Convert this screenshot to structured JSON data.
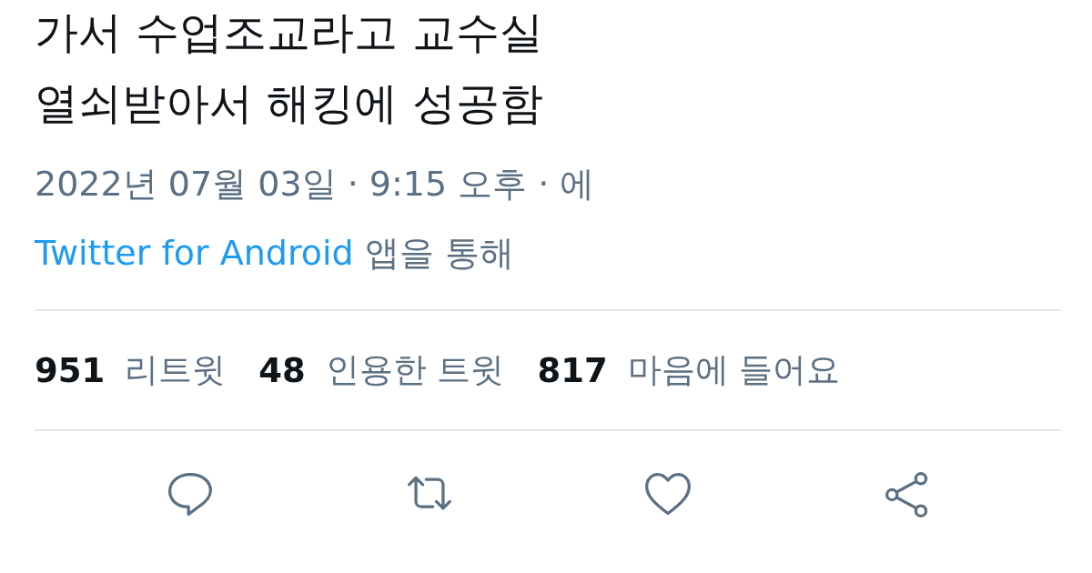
{
  "tweet": {
    "text_lines": [
      "가서 수업조교라고 교수실",
      "열쇠받아서 해킹에 성공함"
    ],
    "timestamp": "2022년 07월 03일 · 9:15 오후 · 에",
    "source": {
      "link": "Twitter for Android",
      "suffix": "앱을 통해"
    }
  },
  "stats": [
    {
      "count": "951",
      "label": "리트윗"
    },
    {
      "count": "48",
      "label": "인용한 트윗"
    },
    {
      "count": "817",
      "label": "마음에 들어요"
    }
  ],
  "actions": [
    {
      "kind": "reply"
    },
    {
      "kind": "retweet"
    },
    {
      "kind": "like"
    },
    {
      "kind": "share"
    }
  ]
}
